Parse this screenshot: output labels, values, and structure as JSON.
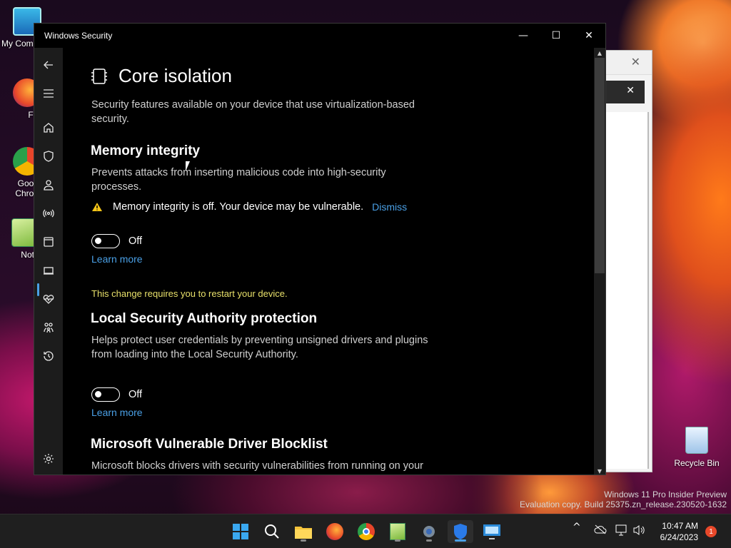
{
  "desktop": {
    "icons": [
      {
        "label": "My Com",
        "icon": "computer-icon"
      },
      {
        "label": "Firefo",
        "icon": "firefox-icon"
      },
      {
        "label": "Goog Chron",
        "icon": "chrome-icon"
      },
      {
        "label": "Notepa",
        "icon": "notepad-icon"
      }
    ],
    "recycle_bin": "Recycle Bin",
    "watermark": {
      "line1": "Windows 11 Pro Insider Preview",
      "line2": "Evaluation copy. Build 25375.zn_release.230520-1632"
    }
  },
  "window": {
    "title": "Windows Security",
    "controls": {
      "minimize": "—",
      "maximize": "☐",
      "close": "✕"
    }
  },
  "sidebar": {
    "items": [
      {
        "name": "back",
        "icon": "back-arrow-icon"
      },
      {
        "name": "menu",
        "icon": "hamburger-menu-icon"
      },
      {
        "name": "home",
        "icon": "home-icon"
      },
      {
        "name": "virus-protection",
        "icon": "shield-icon"
      },
      {
        "name": "account-protection",
        "icon": "person-icon"
      },
      {
        "name": "firewall",
        "icon": "wireless-icon"
      },
      {
        "name": "app-browser-control",
        "icon": "app-window-icon"
      },
      {
        "name": "device-security",
        "icon": "laptop-icon",
        "active": true
      },
      {
        "name": "device-performance",
        "icon": "heart-pulse-icon"
      },
      {
        "name": "family-options",
        "icon": "family-icon"
      },
      {
        "name": "protection-history",
        "icon": "history-icon"
      },
      {
        "name": "settings",
        "icon": "gear-icon"
      }
    ]
  },
  "page": {
    "title": "Core isolation",
    "description": "Security features available on your device that use virtualization-based security.",
    "memory_integrity": {
      "heading": "Memory integrity",
      "description": "Prevents attacks from inserting malicious code into high-security processes.",
      "warning": "Memory integrity is off. Your device may be vulnerable.",
      "dismiss": "Dismiss",
      "toggle_state": "Off",
      "learn_more": "Learn more"
    },
    "restart_notice": "This change requires you to restart your device.",
    "lsa": {
      "heading": "Local Security Authority protection",
      "description": "Helps protect user credentials by preventing unsigned drivers and plugins from loading into the Local Security Authority.",
      "toggle_state": "Off",
      "learn_more": "Learn more"
    },
    "blocklist": {
      "heading": "Microsoft Vulnerable Driver Blocklist",
      "description": "Microsoft blocks drivers with security vulnerabilities from running on your"
    }
  },
  "bg_window": {
    "close": "✕",
    "search_clear": "✕"
  },
  "taskbar": {
    "apps": [
      "start-icon",
      "search-icon",
      "file-explorer-icon",
      "firefox-icon",
      "chrome-icon",
      "notepad-icon",
      "settings-icon",
      "windows-security-icon",
      "remote-desktop-icon"
    ],
    "tray": {
      "chevron": "^"
    },
    "clock": {
      "time": "10:47 AM",
      "date": "6/24/2023"
    },
    "notifications": "1"
  },
  "colors": {
    "accent": "#4aa0e6",
    "warning": "#e8e06a",
    "window_bg": "#000000"
  }
}
